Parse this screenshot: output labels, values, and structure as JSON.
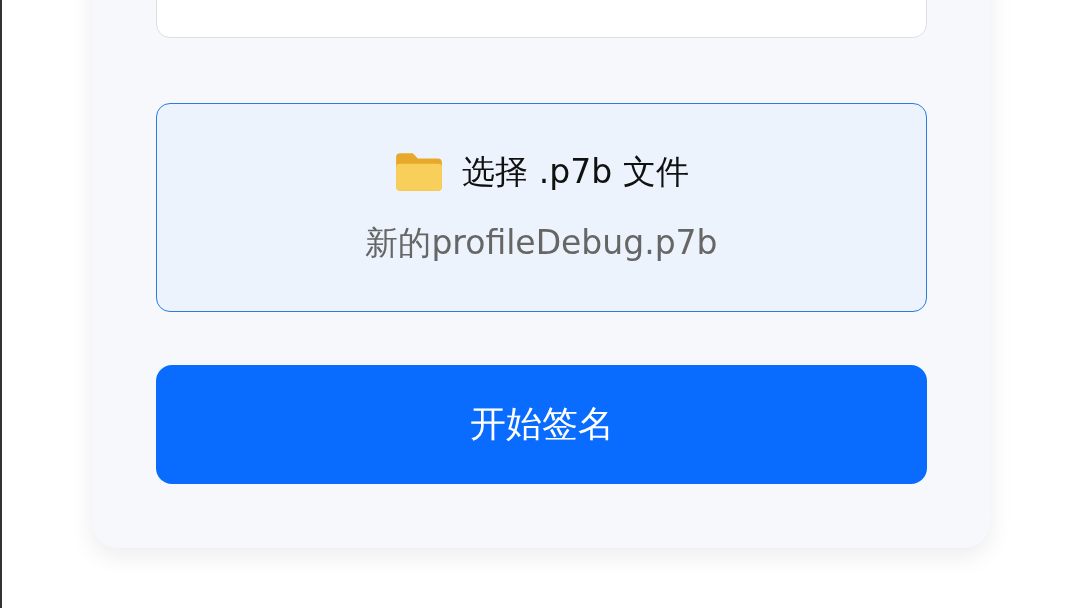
{
  "input_field": {
    "kind": "text"
  },
  "file_picker": {
    "label": "选择 .p7b 文件",
    "file_name": "新的profileDebug.p7b"
  },
  "submit_button": {
    "label": "开始签名"
  }
}
